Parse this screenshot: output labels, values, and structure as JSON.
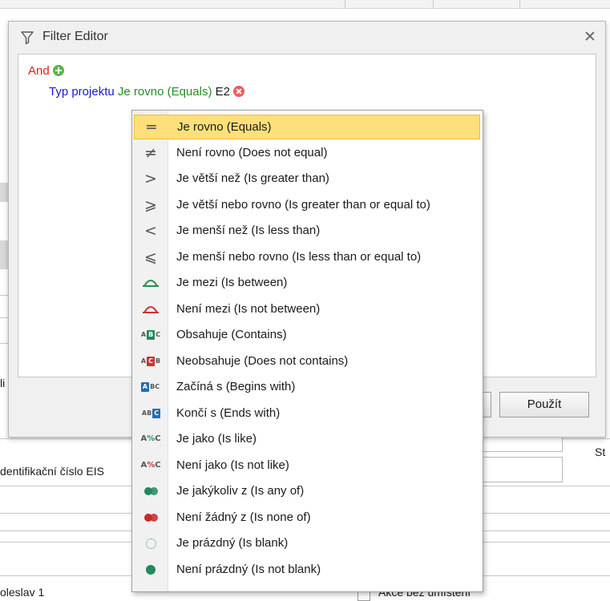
{
  "background": {
    "label_identifikacni": "dentifikační číslo EIS",
    "label_li": "li",
    "label_st": "St",
    "label_oleslav": "oleslav 1",
    "label_akce": "Akce bez umístění"
  },
  "dialog": {
    "title": "Filter Editor",
    "close_glyph": "✕",
    "root_operator": "And",
    "condition": {
      "field": "Typ projektu",
      "operator": "Je rovno (Equals)",
      "value": "E2"
    },
    "apply_label": "Použít"
  },
  "menu": {
    "items": [
      {
        "label": "Je rovno (Equals)",
        "icon": "equals-icon",
        "glyph": "═",
        "selected": true
      },
      {
        "label": "Není rovno (Does not equal)",
        "icon": "not-equal-icon",
        "glyph": "≠"
      },
      {
        "label": "Je větší než (Is greater than)",
        "icon": "greater-than-icon",
        "glyph": ">"
      },
      {
        "label": "Je větší nebo rovno (Is greater than or equal to)",
        "icon": "greater-or-equal-icon",
        "glyph": "⩾"
      },
      {
        "label": "Je menší než (Is less than)",
        "icon": "less-than-icon",
        "glyph": "<"
      },
      {
        "label": "Je menší nebo rovno (Is less than or equal to)",
        "icon": "less-or-equal-icon",
        "glyph": "⩽"
      },
      {
        "label": "Je mezi (Is between)",
        "icon": "between-icon",
        "color": "#2e8b57"
      },
      {
        "label": "Není mezi (Is not between)",
        "icon": "not-between-icon",
        "color": "#d03030"
      },
      {
        "label": "Obsahuje (Contains)",
        "icon": "contains-icon",
        "color": "#1f8a5a"
      },
      {
        "label": "Neobsahuje (Does not contains)",
        "icon": "not-contains-icon",
        "color": "#d03030"
      },
      {
        "label": "Začíná s (Begins with)",
        "icon": "begins-with-icon",
        "color": "#1f6fb2"
      },
      {
        "label": "Končí s (Ends with)",
        "icon": "ends-with-icon",
        "color": "#1f6fb2"
      },
      {
        "label": "Je jako (Is like)",
        "icon": "like-icon",
        "color": "#2e8b57"
      },
      {
        "label": "Není jako (Is not like)",
        "icon": "not-like-icon",
        "color": "#d03030"
      },
      {
        "label": "Je jakýkoliv z (Is any of)",
        "icon": "any-of-icon",
        "color": "#1f8a5a"
      },
      {
        "label": "Není žádný z (Is none of)",
        "icon": "none-of-icon",
        "color": "#c82828"
      },
      {
        "label": "Je prázdný (Is blank)",
        "icon": "blank-icon",
        "color": "#3aa05a"
      },
      {
        "label": "Není prázdný (Is not blank)",
        "icon": "not-blank-icon",
        "color": "#1f8a5a"
      }
    ]
  }
}
